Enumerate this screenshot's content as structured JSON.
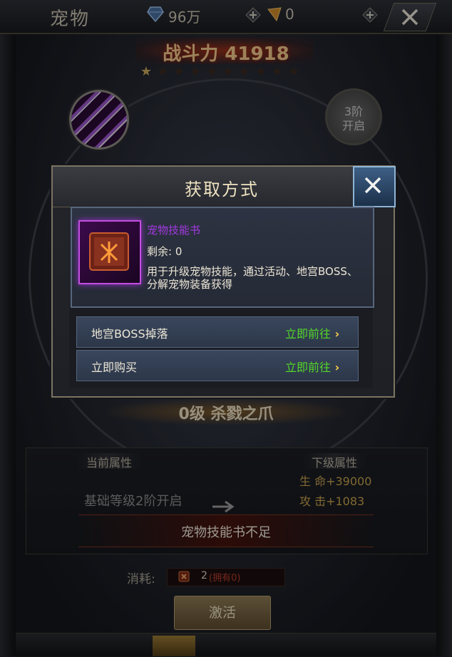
{
  "header": {
    "title": "宠物",
    "gems": "96万",
    "tickets": "0"
  },
  "power": {
    "text": "战斗力 41918",
    "stars_total": 10,
    "stars_lit": 1
  },
  "orbit": {
    "locked_slot_line1": "3阶",
    "locked_slot_line2": "开启"
  },
  "pet": {
    "name": "0级 杀戮之爪",
    "current_attr_title": "当前属性",
    "next_attr_title": "下级属性",
    "current_attr_text": "基础等级2阶开启",
    "next_attrs": [
      "生 命+39000",
      "攻 击+1083"
    ],
    "warning": "宠物技能书不足",
    "cost_label": "消耗:",
    "cost_count": "2",
    "cost_owned": "(拥有0)",
    "activate_label": "激活"
  },
  "modal": {
    "title": "获取方式",
    "item_name": "宠物技能书",
    "remaining": "剩余: 0",
    "description": "用于升级宠物技能，通过活动、地宫BOSS、分解宠物装备获得",
    "options": [
      {
        "label": "地宫BOSS掉落",
        "action": "立即前往"
      },
      {
        "label": "立即购买",
        "action": "立即前往"
      }
    ]
  },
  "colors": {
    "accent_gold": "#c9a85a",
    "item_purple": "#a339e0",
    "action_green": "#54d828",
    "warning_red": "#b53b2c"
  }
}
